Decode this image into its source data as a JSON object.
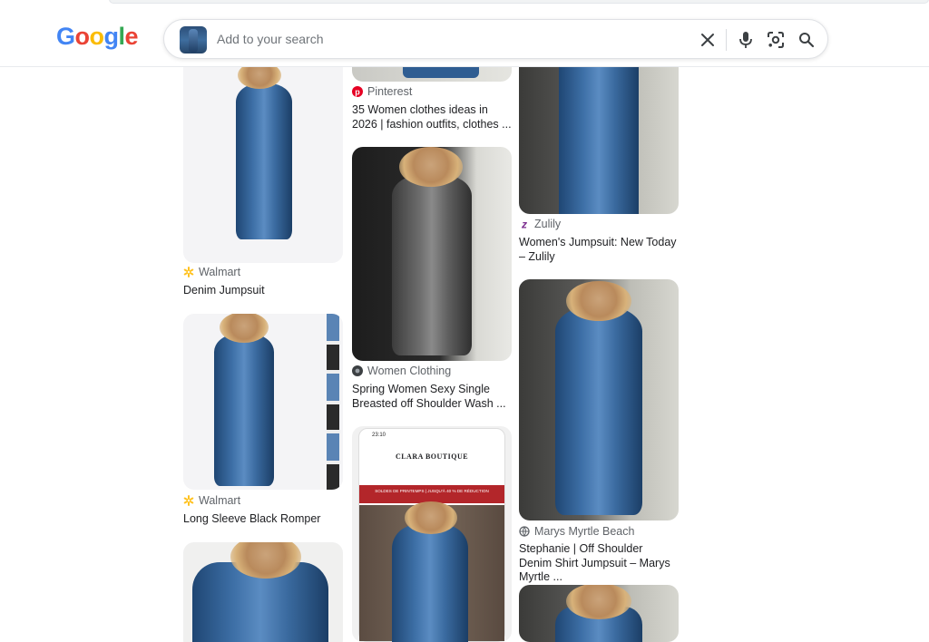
{
  "header": {
    "logo": [
      "G",
      "o",
      "o",
      "g",
      "l",
      "e"
    ],
    "logo_colors": [
      "#4285F4",
      "#EA4335",
      "#FBBC05",
      "#4285F4",
      "#34A853",
      "#EA4335"
    ],
    "search": {
      "placeholder": "Add to your search"
    },
    "icons": [
      "close-icon",
      "mic-icon",
      "lens-icon",
      "search-icon"
    ]
  },
  "results": {
    "col1": [
      {
        "source": "Walmart",
        "title": "Denim Jumpsuit"
      },
      {
        "source": "Walmart",
        "title": "Long Sleeve Black Romper"
      }
    ],
    "col2": [
      {
        "source": "Pinterest",
        "title": "35 Women clothes ideas in 2026 | fashion outfits, clothes ..."
      },
      {
        "source": "Women Clothing",
        "title": "Spring Women Sexy Single Breasted off Shoulder Wash ..."
      },
      {
        "phone_time": "23:10",
        "shop_name": "CLARA BOUTIQUE",
        "banner": "SOLDES DE PRINTEMPS | JUSQU'À 40 % DE RÉDUCTION"
      }
    ],
    "col3": [
      {
        "source": "Zulily",
        "title": "Women's Jumpsuit: New Today – Zulily"
      },
      {
        "source": "Marys Myrtle Beach",
        "title": "Stephanie | Off Shoulder Denim Shirt Jumpsuit – Marys Myrtle ..."
      }
    ]
  },
  "colors": {
    "walmart": "#FFC220",
    "pinterest": "#E60023",
    "zulily": "#7B2D8E",
    "accent": "#1A73E8"
  }
}
